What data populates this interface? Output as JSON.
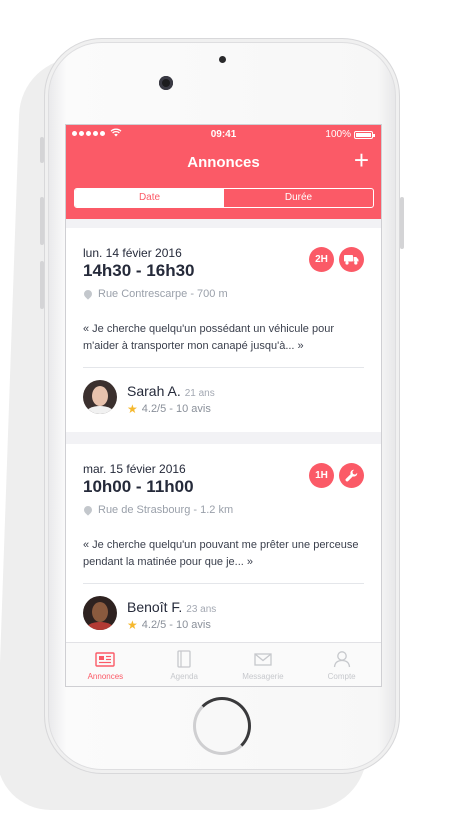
{
  "status_bar": {
    "time": "09:41",
    "battery": "100%"
  },
  "header": {
    "title": "Annonces",
    "add_icon": "plus-icon"
  },
  "segments": {
    "date": "Date",
    "duree": "Durée",
    "selected": "date"
  },
  "colors": {
    "accent": "#fb5a67",
    "star": "#f5b82e"
  },
  "cards": [
    {
      "date": "lun. 14 févier 2016",
      "hours": "14h30 - 16h30",
      "location": "Rue Contrescarpe - 700 m",
      "duration_badge": "2H",
      "category_icon": "truck-icon",
      "quote": "« Je cherche quelqu'un possédant un véhicule  pour m'aider à transporter mon canapé jusqu'à... »",
      "user": {
        "name": "Sarah A.",
        "age": "21 ans",
        "rating": "4.2/5 - 10 avis"
      }
    },
    {
      "date": "mar. 15 févier 2016",
      "hours": "10h00 - 11h00",
      "location": "Rue de Strasbourg - 1.2 km",
      "duration_badge": "1H",
      "category_icon": "wrench-icon",
      "quote": "« Je cherche quelqu'un pouvant me prêter une perceuse pendant la matinée pour que je... »",
      "user": {
        "name": "Benoît F.",
        "age": "23 ans",
        "rating": "4.2/5 - 10 avis"
      }
    }
  ],
  "tabs": [
    {
      "label": "Annonces",
      "icon": "newspaper-icon",
      "active": true
    },
    {
      "label": "Agenda",
      "icon": "agenda-icon",
      "active": false
    },
    {
      "label": "Messagerie",
      "icon": "envelope-icon",
      "active": false
    },
    {
      "label": "Compte",
      "icon": "user-icon",
      "active": false
    }
  ]
}
